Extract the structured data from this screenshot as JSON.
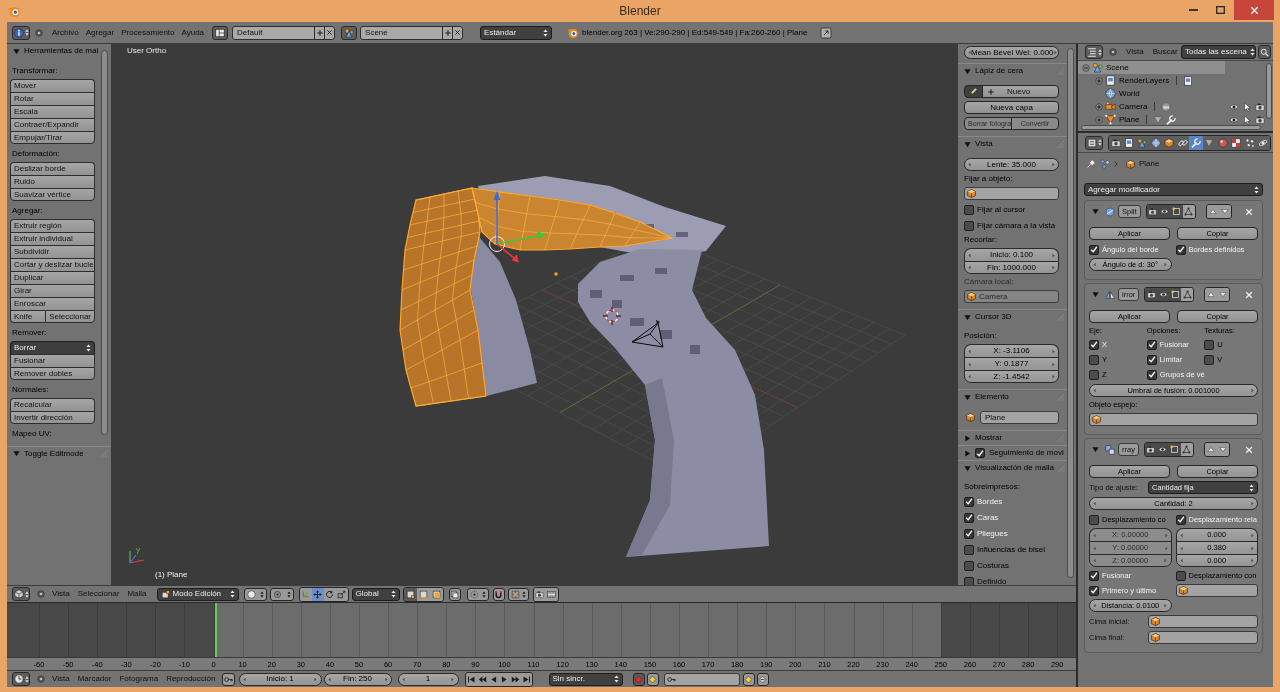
{
  "window": {
    "title": "Blender"
  },
  "info_header": {
    "menus": [
      "Archivo",
      "Agregar",
      "Procesamiento",
      "Ayuda"
    ],
    "screen_layout": "Default",
    "scene": "Scene",
    "render_engine": "Estándar",
    "stats": "blender.org 263 | Ve:290-290 | Ed:549-549 | Fa:260-260 | Plane"
  },
  "tool_shelf": {
    "panels": [
      {
        "title": "Herramientas de mal",
        "expanded": true,
        "sections": [
          {
            "label": "Transformar:",
            "items": [
              {
                "kind": "button",
                "label": "Mover"
              },
              {
                "kind": "button",
                "label": "Rotar"
              },
              {
                "kind": "button",
                "label": "Escala"
              },
              {
                "kind": "button",
                "label": "Contraer/Expandir"
              },
              {
                "kind": "button",
                "label": "Empujar/Tirar"
              }
            ]
          },
          {
            "label": "Deformación:",
            "items": [
              {
                "kind": "button",
                "label": "Deslizar borde"
              },
              {
                "kind": "button",
                "label": "Ruido"
              },
              {
                "kind": "button",
                "label": "Suavizar vértice"
              }
            ]
          },
          {
            "label": "Agregar:",
            "items": [
              {
                "kind": "button",
                "label": "Extruir región"
              },
              {
                "kind": "button",
                "label": "Extruir individual"
              },
              {
                "kind": "button",
                "label": "Subdividir"
              },
              {
                "kind": "button",
                "label": "Cortar y deslizar bucle"
              },
              {
                "kind": "button",
                "label": "Duplicar"
              },
              {
                "kind": "button",
                "label": "Girar"
              },
              {
                "kind": "button",
                "label": "Enroscar"
              },
              {
                "kind": "button_pair",
                "labels": [
                  "Knife",
                  "Seleccionar"
                ]
              }
            ]
          },
          {
            "label": "Remover:",
            "items": [
              {
                "kind": "dropdown",
                "label": "Borrar"
              },
              {
                "kind": "button",
                "label": "Fusionar"
              },
              {
                "kind": "button",
                "label": "Remover dobles"
              }
            ]
          },
          {
            "label": "Normales:",
            "items": [
              {
                "kind": "button",
                "label": "Recalcular"
              },
              {
                "kind": "button",
                "label": "Invertir dirección"
              }
            ]
          },
          {
            "label": "Mapeo UV:"
          }
        ]
      },
      {
        "title": "Toggle Editmode",
        "expanded": true
      }
    ]
  },
  "viewport": {
    "view_name": "User Ortho",
    "object_info": "(1) Plane"
  },
  "sidebar": {
    "top_field": "Mean Bevel Wei: 0.000",
    "panels": [
      {
        "title": "Lápiz de cera",
        "expanded": true,
        "items": [
          {
            "kind": "pencil_row",
            "label": "Nuevo",
            "selected": true
          },
          {
            "kind": "button",
            "label": "Nueva capa"
          },
          {
            "kind": "button_pair",
            "labels": [
              "Borrar fotogra",
              "Convertir"
            ],
            "disabled": true
          }
        ]
      },
      {
        "title": "Vista",
        "expanded": true,
        "items": [
          {
            "kind": "number",
            "label": "Lente: 35.000"
          },
          {
            "kind": "label",
            "label": "Fijar a objeto:",
            "disabled": false
          },
          {
            "kind": "object_field",
            "disabled": false
          },
          {
            "kind": "checkbox",
            "label": "Fijar al cursor",
            "checked": false
          },
          {
            "kind": "checkbox",
            "label": "Fijar cámara a la vista",
            "checked": false
          },
          {
            "kind": "label",
            "label": "Recortar:",
            "disabled": false
          },
          {
            "kind": "number_group",
            "values": [
              "Inicio: 0.100",
              "Fin: 1000.000"
            ]
          },
          {
            "kind": "label",
            "label": "Cámara local:",
            "disabled": true
          },
          {
            "kind": "object_field",
            "value": "Camera",
            "disabled": true
          }
        ]
      },
      {
        "title": "Cursor 3D",
        "expanded": true,
        "items": [
          {
            "kind": "label",
            "label": "Posición:"
          },
          {
            "kind": "number_group",
            "values": [
              "X: -3.1106",
              "Y: 0.1877",
              "Z: -1.4542"
            ]
          }
        ]
      },
      {
        "title": "Elemento",
        "expanded": true,
        "items": [
          {
            "kind": "name_field",
            "value": "Plane"
          }
        ]
      },
      {
        "title": "Mostrar",
        "expanded": false
      },
      {
        "title": "Seguimiento de movi",
        "expanded": false,
        "checked": true
      },
      {
        "title": "Visualización de malla",
        "expanded": true,
        "items": [
          {
            "kind": "label",
            "label": "Sobreimpresos:"
          },
          {
            "kind": "checkbox",
            "label": "Bordes",
            "checked": true
          },
          {
            "kind": "checkbox",
            "label": "Caras",
            "checked": true
          },
          {
            "kind": "checkbox",
            "label": "Pliegues",
            "checked": true
          },
          {
            "kind": "checkbox",
            "label": "Influencias de bisel",
            "checked": false
          },
          {
            "kind": "checkbox",
            "label": "Costuras",
            "checked": false
          },
          {
            "kind": "checkbox",
            "label": "Definido",
            "checked": false
          }
        ]
      }
    ]
  },
  "outliner": {
    "menus": [
      "Vista",
      "Buscar"
    ],
    "filter": "Todas las escena",
    "tree": [
      {
        "kind": "scene",
        "label": "Scene",
        "selected": true,
        "expanded": true,
        "children": [
          {
            "kind": "render_layers",
            "label": "RenderLayers",
            "selected": false,
            "expanded": false
          },
          {
            "kind": "world",
            "label": "World",
            "selected": false
          },
          {
            "kind": "camera",
            "label": "Camera",
            "selected": false,
            "expanded": false
          },
          {
            "kind": "mesh",
            "label": "Plane",
            "selected": false,
            "expanded": false
          }
        ]
      }
    ]
  },
  "properties": {
    "tabs": [
      {
        "kind": "render",
        "selected": false
      },
      {
        "kind": "render_layers",
        "selected": false
      },
      {
        "kind": "scene",
        "selected": false
      },
      {
        "kind": "world",
        "selected": false
      },
      {
        "kind": "object",
        "selected": false
      },
      {
        "kind": "constraints",
        "selected": false
      },
      {
        "kind": "modifiers",
        "selected": true
      },
      {
        "kind": "data",
        "selected": false
      },
      {
        "kind": "material",
        "selected": false
      },
      {
        "kind": "texture",
        "selected": false
      },
      {
        "kind": "particles",
        "selected": false
      },
      {
        "kind": "physics",
        "selected": false
      }
    ],
    "context": "Plane",
    "add_menu": "Agregar modificador",
    "modifiers": [
      {
        "kind": "edge_split",
        "name": "Split",
        "expanded": true,
        "toggles": [
          {
            "kind": "render",
            "on": true
          },
          {
            "kind": "realtime",
            "on": true
          },
          {
            "kind": "editmode",
            "on": true
          },
          {
            "kind": "cage",
            "on": false
          }
        ],
        "actions": [
          "Aplicar",
          "Copiar"
        ],
        "blocks": [
          {
            "kind": "columns",
            "columns": [
              [
                {
                  "kind": "checkbox",
                  "label": "Ángulo del borde",
                  "checked": true
                },
                {
                  "kind": "number",
                  "label": "Ángulo de d: 30°"
                }
              ],
              [
                {
                  "kind": "checkbox",
                  "label": "Bordes definidos",
                  "checked": true
                }
              ]
            ]
          }
        ]
      },
      {
        "kind": "mirror",
        "name": "irror",
        "expanded": true,
        "toggles": [
          {
            "kind": "render",
            "on": true
          },
          {
            "kind": "realtime",
            "on": true
          },
          {
            "kind": "editmode",
            "on": true
          },
          {
            "kind": "cage",
            "on": false
          }
        ],
        "actions": [
          "Aplicar",
          "Copiar"
        ],
        "blocks": [
          {
            "kind": "columns",
            "columns": [
              [
                {
                  "kind": "label",
                  "label": "Eje:"
                },
                {
                  "kind": "checkbox",
                  "label": "X",
                  "checked": true
                },
                {
                  "kind": "checkbox",
                  "label": "Y",
                  "checked": false
                },
                {
                  "kind": "checkbox",
                  "label": "Z",
                  "checked": false
                }
              ],
              [
                {
                  "kind": "label",
                  "label": "Opciones:"
                },
                {
                  "kind": "checkbox",
                  "label": "Fusionar",
                  "checked": true
                },
                {
                  "kind": "checkbox",
                  "label": "Limitar",
                  "checked": true
                },
                {
                  "kind": "checkbox",
                  "label": "Grupos de vé",
                  "checked": true
                }
              ],
              [
                {
                  "kind": "label",
                  "label": "Texturas:"
                },
                {
                  "kind": "checkbox",
                  "label": "U",
                  "checked": false
                },
                {
                  "kind": "checkbox",
                  "label": "V",
                  "checked": false
                }
              ]
            ]
          },
          {
            "kind": "number",
            "label": "Umbral de fusión: 0.001000"
          },
          {
            "kind": "label",
            "label": "Objeto espejo:"
          },
          {
            "kind": "object_field"
          }
        ]
      },
      {
        "kind": "array",
        "name": "rray",
        "expanded": true,
        "toggles": [
          {
            "kind": "render",
            "on": true
          },
          {
            "kind": "realtime",
            "on": true
          },
          {
            "kind": "editmode",
            "on": true
          },
          {
            "kind": "cage",
            "on": false
          }
        ],
        "actions": [
          "Aplicar",
          "Copiar"
        ],
        "blocks": [
          {
            "kind": "labeled_dropdown",
            "label": "Tipo de ajuste:",
            "value": "Cantidad fija"
          },
          {
            "kind": "number",
            "label": "Cantidad: 2"
          },
          {
            "kind": "columns",
            "columns": [
              [
                {
                  "kind": "checkbox",
                  "label": "Desplazamiento co",
                  "checked": false
                },
                {
                  "kind": "number_group",
                  "values": [
                    "X: 0.00000",
                    "Y: 0.00000",
                    "Z: 0.00000"
                  ],
                  "disabled": true
                },
                {
                  "kind": "checkbox",
                  "label": "Fusionar",
                  "checked": true
                },
                {
                  "kind": "checkbox",
                  "label": "Primero y último",
                  "checked": true
                },
                {
                  "kind": "number",
                  "label": "Distancia: 0.0100"
                }
              ],
              [
                {
                  "kind": "checkbox",
                  "label": "Desplazamiento rela",
                  "checked": true
                },
                {
                  "kind": "number_group",
                  "values": [
                    "0.000",
                    "0.380",
                    "0.000"
                  ],
                  "disabled": false
                },
                {
                  "kind": "checkbox",
                  "label": "Desplazamiento con",
                  "checked": false
                },
                {
                  "kind": "object_field"
                }
              ]
            ]
          },
          {
            "kind": "labeled_field",
            "label": "Cima inicial:"
          },
          {
            "kind": "labeled_field",
            "label": "Cima final:"
          }
        ]
      }
    ]
  },
  "view3d_header": {
    "menus": [
      "Vista",
      "Seleccionar",
      "Malla"
    ],
    "mode": "Modo Edición",
    "manipulators": [
      {
        "kind": "toggle",
        "selected": false
      },
      {
        "kind": "translate",
        "selected": true
      },
      {
        "kind": "rotate",
        "selected": false
      },
      {
        "kind": "scale",
        "selected": false
      }
    ],
    "orientation": "Global",
    "select_modes": [
      {
        "kind": "vertex",
        "selected": true
      },
      {
        "kind": "edge",
        "selected": false
      },
      {
        "kind": "face",
        "selected": false
      }
    ]
  },
  "timeline": {
    "ticks": [
      "-60",
      "-50",
      "-40",
      "-30",
      "-20",
      "-10",
      "0",
      "10",
      "20",
      "30",
      "40",
      "50",
      "60",
      "70",
      "80",
      "90",
      "100",
      "110",
      "120",
      "130",
      "140",
      "150",
      "160",
      "170",
      "180",
      "190",
      "200",
      "210",
      "220",
      "230",
      "240",
      "250",
      "260",
      "270",
      "280",
      "290"
    ]
  },
  "timeline_header": {
    "menus": [
      "Vista",
      "Marcador",
      "Fotograma",
      "Reproducción"
    ],
    "start": "Inicio: 1",
    "end": "Fin: 250",
    "frame": "1",
    "sync": "Sin sincr."
  }
}
